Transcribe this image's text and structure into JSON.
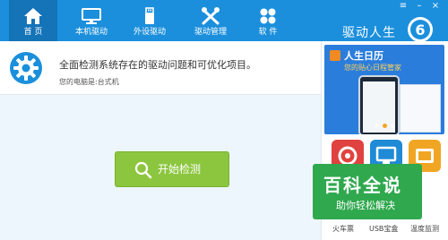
{
  "window": {
    "brand": "驱动人生",
    "controls": {
      "menu": "≡",
      "minimize": "–",
      "close": "×"
    }
  },
  "tabs": [
    {
      "label": "首 页",
      "icon": "home-icon",
      "active": true
    },
    {
      "label": "本机驱动",
      "icon": "monitor-icon",
      "active": false
    },
    {
      "label": "外设驱动",
      "icon": "usb-icon",
      "active": false
    },
    {
      "label": "驱动管理",
      "icon": "wrench-screwdriver-icon",
      "active": false
    },
    {
      "label": "软 件",
      "icon": "apps-icon",
      "active": false
    }
  ],
  "main": {
    "headline": "全面检测系统存在的驱动问题和可优化项目。",
    "pc_type": "您的电脑是:台式机",
    "scan_button": "开始检测"
  },
  "side": {
    "ad": {
      "title": "人生日历",
      "slogan": "您的贴心日程管家",
      "active_slide": 1,
      "slide_count": 3
    },
    "tools": [
      {
        "label": "火车票",
        "icon": "train-ticket-icon",
        "color": "#e0433f"
      },
      {
        "label": "USB宝盒",
        "icon": "usb-box-icon",
        "color": "#1f8ad6"
      },
      {
        "label": "温度监测",
        "icon": "temperature-icon",
        "color": "#f0a623"
      }
    ]
  },
  "watermark": {
    "title": "百科全说",
    "subtitle": "助你轻松解决"
  },
  "colors": {
    "topbar": "#1b8fdc",
    "active_tab": "#1573b8",
    "scan_button": "#8cc63f",
    "main_bg": "#eef6fd",
    "watermark": "#2fa84e"
  }
}
